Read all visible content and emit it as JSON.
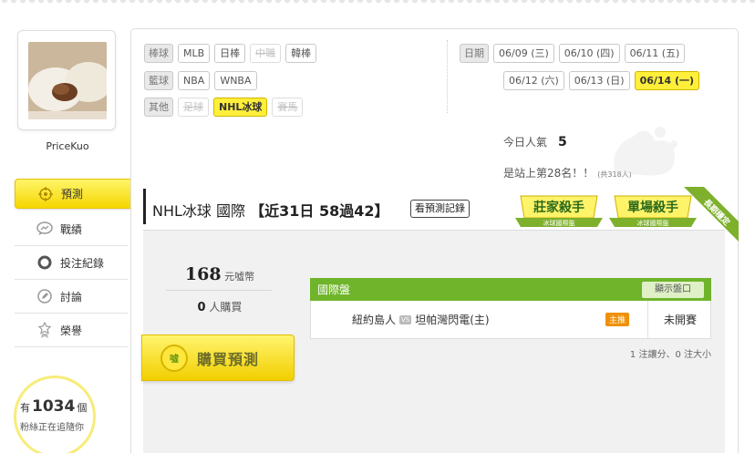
{
  "profile": {
    "username": "PriceKuo"
  },
  "nav": [
    {
      "label": "預測",
      "icon": "target-icon",
      "active": true
    },
    {
      "label": "戰績",
      "icon": "chart-bubble-icon",
      "active": false
    },
    {
      "label": "投注紀錄",
      "icon": "circle-icon",
      "active": false
    },
    {
      "label": "討論",
      "icon": "pencil-icon",
      "active": false
    },
    {
      "label": "榮譽",
      "icon": "medal-icon",
      "active": false
    }
  ],
  "fans": {
    "prefix": "有",
    "count": "1034",
    "suffix": "個",
    "subtitle": "粉絲正在追隨你"
  },
  "filters": {
    "baseball": {
      "label": "棒球",
      "items": [
        "MLB",
        "日棒",
        "中職",
        "韓棒"
      ]
    },
    "basketball": {
      "label": "籃球",
      "items": [
        "NBA",
        "WNBA"
      ]
    },
    "other": {
      "label": "其他",
      "items": [
        "足球",
        "NHL冰球",
        "賽馬"
      ]
    },
    "date": {
      "label": "日期",
      "items": [
        "06/09 (三)",
        "06/10 (四)",
        "06/11 (五)",
        "06/12 (六)",
        "06/13 (日)",
        "06/14 (一)"
      ]
    }
  },
  "stats": {
    "popularity_label": "今日人氣",
    "popularity_value": "5",
    "rank_text": "是站上第28名！！",
    "rank_sub": "(共318人)"
  },
  "header": {
    "title_prefix": "NHL冰球 國際",
    "title_record": "【近31日 58過42】",
    "history_button": "看預測記錄",
    "badge1_title": "莊家殺手",
    "badge1_sub": "冰球國際盤",
    "badge2_title": "單場殺手",
    "badge2_sub": "冰球國際盤",
    "ribbon": "長期穩定"
  },
  "price": {
    "value": "168",
    "unit": "元噓幣"
  },
  "buyers": {
    "count": "0",
    "label": "人購買"
  },
  "buy_button": {
    "label": "購買預測",
    "coin": "噓"
  },
  "market": {
    "title": "國際盤",
    "show_button": "顯示盤口",
    "away": "紐約島人",
    "vs": "VS",
    "home": "坦帕灣閃電(主)",
    "main_badge": "主推",
    "status": "未開賽"
  },
  "note": "1 注讓分、0 注大小",
  "colors": {
    "accent_yellow": "#f5d700",
    "green": "#6fb42a"
  }
}
